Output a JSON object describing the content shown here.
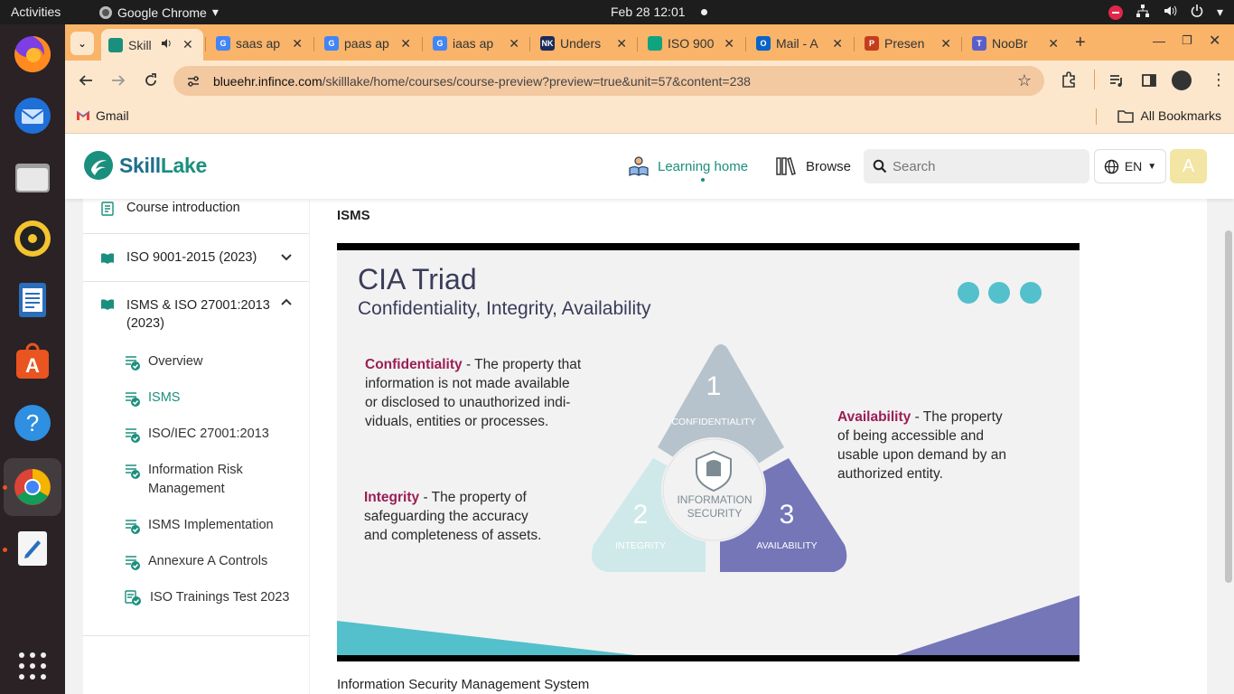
{
  "system": {
    "activities": "Activities",
    "app_name": "Google Chrome",
    "clock": "Feb 28  12:01"
  },
  "dock": {
    "apps": [
      "firefox-icon",
      "thunderbird-icon",
      "files-icon",
      "rhythmbox-icon",
      "libreoffice-impress-icon",
      "app-center-icon",
      "help-icon",
      "chrome-icon",
      "text-editor-icon",
      "show-apps-icon"
    ]
  },
  "browser": {
    "tabs": [
      {
        "title": "Skill",
        "favicon_color": "#1b8f7e",
        "favicon_text": ""
      },
      {
        "title": "saas ap",
        "favicon_color": "#4285f4",
        "favicon_text": "G"
      },
      {
        "title": "paas ap",
        "favicon_color": "#4285f4",
        "favicon_text": "G"
      },
      {
        "title": "iaas ap",
        "favicon_color": "#4285f4",
        "favicon_text": "G"
      },
      {
        "title": "Unders",
        "favicon_color": "#1a2a5a",
        "favicon_text": "NK"
      },
      {
        "title": "ISO 900",
        "favicon_color": "#10a37f",
        "favicon_text": ""
      },
      {
        "title": "Mail - A",
        "favicon_color": "#0a64c8",
        "favicon_text": "O"
      },
      {
        "title": "Presen",
        "favicon_color": "#c43e1c",
        "favicon_text": "P"
      },
      {
        "title": "NooBr",
        "favicon_color": "#5a5ec8",
        "favicon_text": "T"
      }
    ],
    "url_host": "blueehr.infince.com",
    "url_path": "/skilllake/home/courses/course-preview?preview=true&unit=57&content=238",
    "bookmarks": {
      "gmail": "Gmail",
      "all": "All Bookmarks"
    }
  },
  "site": {
    "logo_text_1": "Skill",
    "logo_text_2": "Lake",
    "nav_learning_home": "Learning home",
    "nav_browse": "Browse",
    "search_placeholder": "Search",
    "language": "EN",
    "avatar_letter": "A",
    "accent": "#1b8f7e"
  },
  "sidebar": {
    "course_intro": "Course introduction",
    "section_1": "ISO 9001-2015 (2023)",
    "section_2_line1": "ISMS & ISO 27001:2013",
    "section_2_line2": "(2023)",
    "items": [
      {
        "label": "Overview"
      },
      {
        "label": "ISMS"
      },
      {
        "label": "ISO/IEC 27001:2013"
      },
      {
        "label_1": "Information Risk",
        "label_2": "Management"
      },
      {
        "label": "ISMS Implementation"
      },
      {
        "label": "Annexure A Controls"
      },
      {
        "label": "ISO Trainings Test 2023"
      }
    ]
  },
  "content": {
    "heading": "ISMS",
    "footer_text": "Information Security Management System",
    "slide": {
      "title": "CIA Triad",
      "subtitle": "Confidentiality, Integrity, Availability",
      "conf_kw": "Confidentiality",
      "conf_l1": " - The property that",
      "conf_l2": "information is not made available",
      "conf_l3": "or disclosed to unauthorized indi-",
      "conf_l4": "viduals, entities or processes.",
      "int_kw": "Integrity",
      "int_l1": " - The property of",
      "int_l2": "safeguarding the accuracy",
      "int_l3": "and completeness of assets.",
      "av_kw": "Availability",
      "av_l1": "  - The property",
      "av_l2": "of being accessible and",
      "av_l3": "usable upon demand by an",
      "av_l4": "authorized entity.",
      "tri_1_num": "1",
      "tri_1_label": "CONFIDENTIALITY",
      "tri_2_num": "2",
      "tri_2_label": "INTEGRITY",
      "tri_3_num": "3",
      "tri_3_label": "AVAILABILITY",
      "center_l1": "INFORMATION",
      "center_l2": "SECURITY",
      "colors": {
        "conf": "#b6c3cc",
        "integ": "#cfe9ea",
        "avail": "#7476b8",
        "keyword": "#9a1e55",
        "dots": "#53c0cc"
      }
    }
  }
}
